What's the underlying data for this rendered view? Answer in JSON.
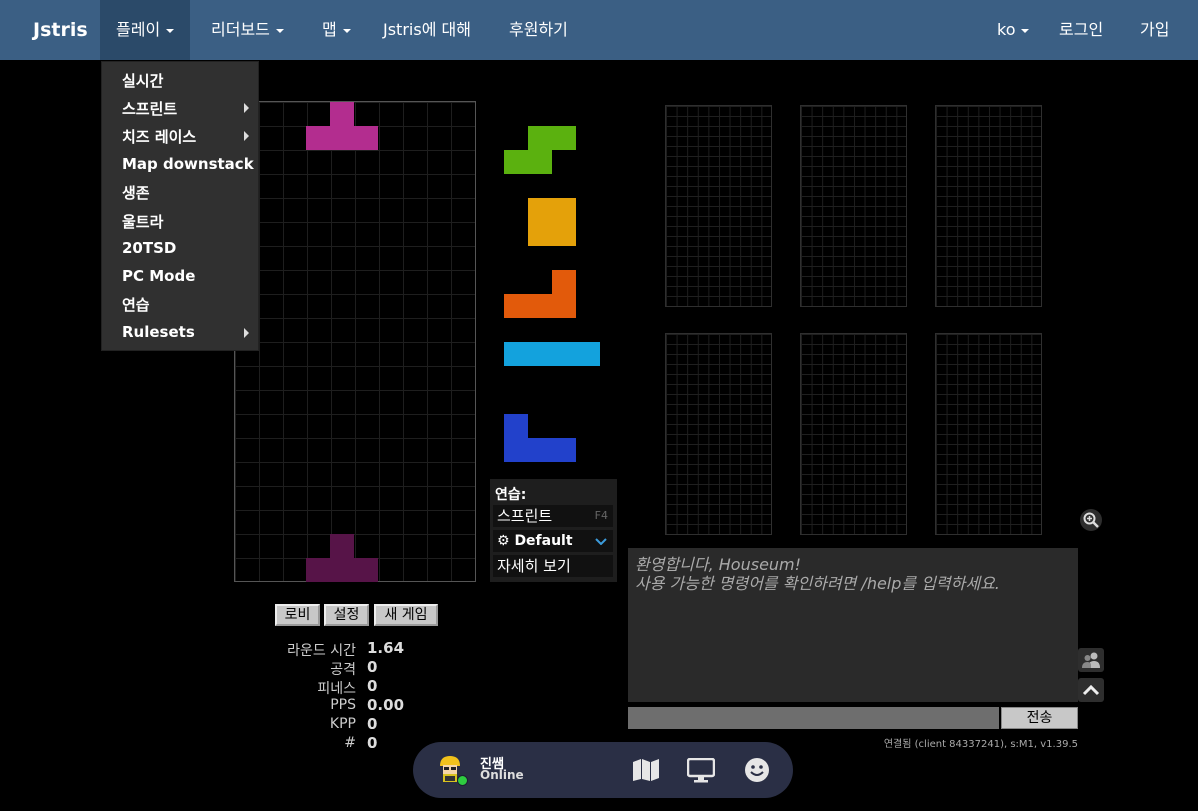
{
  "navbar": {
    "brand": "Jstris",
    "items": [
      {
        "label": "플레이",
        "dropdown": true
      },
      {
        "label": "리더보드",
        "dropdown": true
      },
      {
        "label": "맵",
        "dropdown": true
      },
      {
        "label": "Jstris에 대해",
        "dropdown": false
      },
      {
        "label": "후원하기",
        "dropdown": false
      }
    ],
    "right": {
      "language": "ko",
      "login": "로그인",
      "signup": "가입"
    },
    "color": "#3b5f84"
  },
  "play_menu": {
    "items": [
      {
        "label": "실시간",
        "submenu": false
      },
      {
        "label": "스프린트",
        "submenu": true
      },
      {
        "label": "치즈 레이스",
        "submenu": true
      },
      {
        "label": "Map downstack",
        "submenu": false
      },
      {
        "label": "생존",
        "submenu": false
      },
      {
        "label": "울트라",
        "submenu": false
      },
      {
        "label": "20TSD",
        "submenu": false
      },
      {
        "label": "PC Mode",
        "submenu": false
      },
      {
        "label": "연습",
        "submenu": false
      },
      {
        "label": "Rulesets",
        "submenu": true
      }
    ]
  },
  "board": {
    "active_piece": {
      "type": "T",
      "color": "#b32d8f"
    },
    "ghost_piece": {
      "type": "T",
      "color": "#571448"
    }
  },
  "next_queue": [
    {
      "type": "S",
      "color": "#5bb10f"
    },
    {
      "type": "O",
      "color": "#e4a10a"
    },
    {
      "type": "L",
      "color": "#e25a0b"
    },
    {
      "type": "I",
      "color": "#13a2dd"
    },
    {
      "type": "J",
      "color": "#2241cb"
    }
  ],
  "mode_panel": {
    "title": "연습:",
    "mode": "스프린트",
    "shortcut": "F4",
    "ruleset": "Default",
    "details": "자세히 보기"
  },
  "buttons": {
    "lobby": "로비",
    "settings": "설정",
    "new_game": "새 게임"
  },
  "stats": [
    {
      "label": "라운드 시간",
      "value": "1.64"
    },
    {
      "label": "공격",
      "value": "0"
    },
    {
      "label": "피네스",
      "value": "0"
    },
    {
      "label": "PPS",
      "value": "0.00"
    },
    {
      "label": "KPP",
      "value": "0"
    },
    {
      "label": "#",
      "value": "0"
    }
  ],
  "chat": {
    "lines": [
      "환영합니다, Houseum!",
      "사용 가능한 명령어를 확인하려면 /help를 입력하세요."
    ],
    "input_value": "",
    "send_label": "전송",
    "status": "연결됨 (client 84337241), s:M1, v1.39.5"
  },
  "bottom_bar": {
    "user_name": "진쌤",
    "user_status": "Online",
    "icons": [
      "map-icon",
      "monitor-icon",
      "smiley-icon"
    ]
  }
}
